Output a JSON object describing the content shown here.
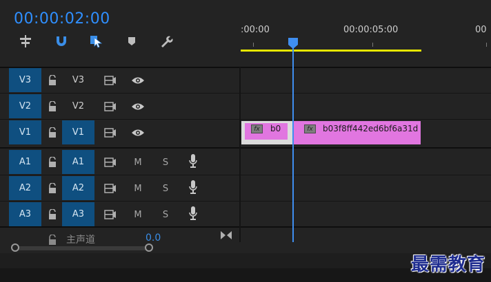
{
  "header": {
    "timecode": "00:00:02:00",
    "tools": [
      "nest-sequence-icon",
      "snap-magnet-icon",
      "linked-selection-icon",
      "add-marker-icon",
      "timeline-settings-wrench-icon"
    ]
  },
  "ruler": {
    "labels": [
      ":00:00",
      "00:00:05:00",
      "00"
    ],
    "playhead_color": "#3f8ef0",
    "work_area_color": "#e7e700"
  },
  "video_tracks": [
    {
      "source": "V3",
      "target": "V3"
    },
    {
      "source": "V2",
      "target": "V2"
    },
    {
      "source": "V1",
      "target": "V1"
    }
  ],
  "audio_tracks": [
    {
      "source": "A1",
      "target": "A1",
      "mute": "M",
      "solo": "S"
    },
    {
      "source": "A2",
      "target": "A2",
      "mute": "M",
      "solo": "S"
    },
    {
      "source": "A3",
      "target": "A3",
      "mute": "M",
      "solo": "S"
    }
  ],
  "clips": [
    {
      "fx": "fx",
      "name": "b0"
    },
    {
      "fx": "fx",
      "name": "b03f8ff442ed6bf6a31d"
    }
  ],
  "master": {
    "label": "主声道",
    "value": "0.0"
  },
  "watermark": "最需教育",
  "colors": {
    "track_target_blue": "#0f4f80",
    "clip_pink": "#e176e0",
    "timecode_blue": "#2f8fff"
  }
}
